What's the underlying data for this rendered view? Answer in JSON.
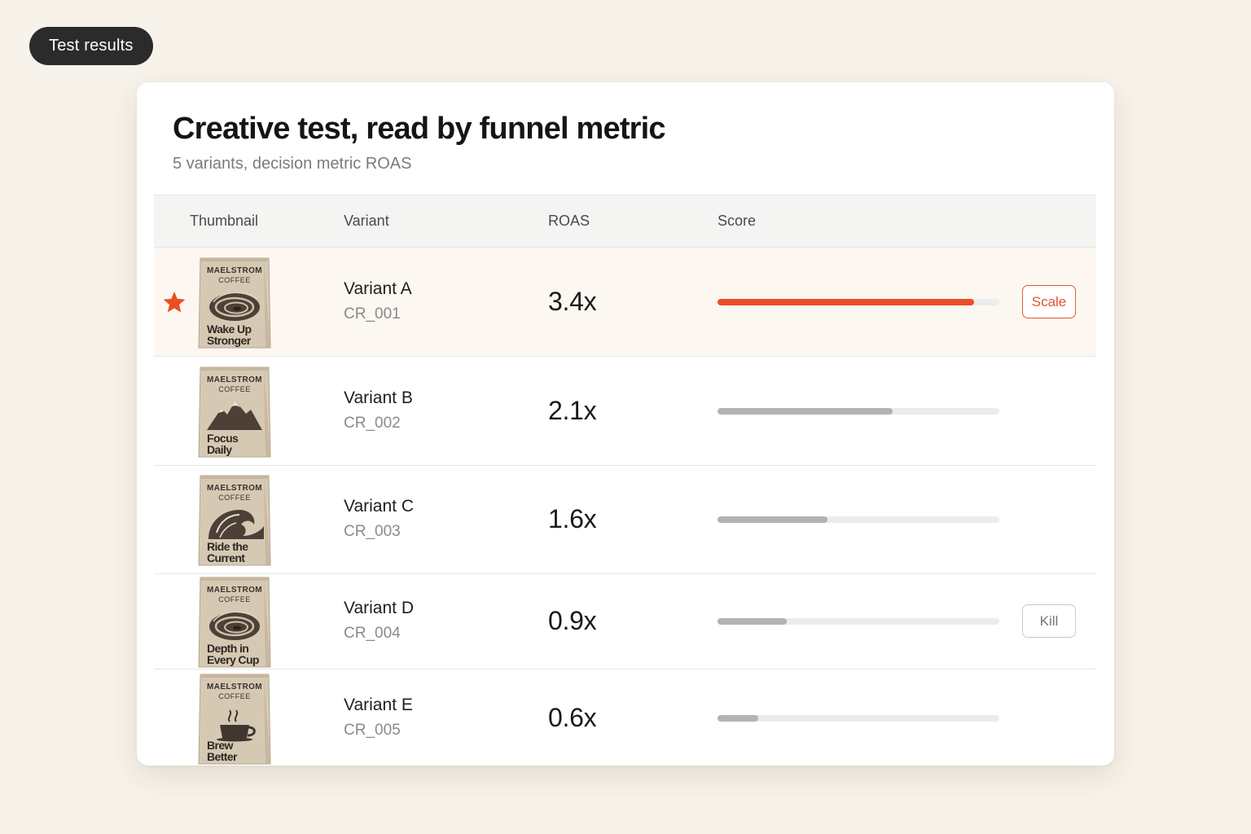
{
  "header": {
    "pill_label": "Test results"
  },
  "card": {
    "title": "Creative test, read by funnel metric",
    "subtitle": "5 variants, decision metric ROAS"
  },
  "table": {
    "columns": [
      "Thumbnail",
      "Variant",
      "ROAS",
      "Score"
    ],
    "rows": [
      {
        "variant": "Variant A",
        "code": "CR_001",
        "roas": "3.4x",
        "score": 0.91,
        "starred": true,
        "action": "Scale",
        "brand_top": "MAELSTROM",
        "brand_bottom": "COFFEE",
        "tagline_1": "Wake Up",
        "tagline_2": "Stronger",
        "art": "swirl"
      },
      {
        "variant": "Variant B",
        "code": "CR_002",
        "roas": "2.1x",
        "score": 0.62,
        "starred": false,
        "action": "",
        "brand_top": "MAELSTROM",
        "brand_bottom": "COFFEE",
        "tagline_1": "Focus",
        "tagline_2": "Daily",
        "art": "mountain"
      },
      {
        "variant": "Variant C",
        "code": "CR_003",
        "roas": "1.6x",
        "score": 0.39,
        "starred": false,
        "action": "",
        "brand_top": "MAELSTROM",
        "brand_bottom": "COFFEE",
        "tagline_1": "Ride the",
        "tagline_2": "Current",
        "art": "wave"
      },
      {
        "variant": "Variant D",
        "code": "CR_004",
        "roas": "0.9x",
        "score": 0.245,
        "starred": false,
        "action": "Kill",
        "brand_top": "MAELSTROM",
        "brand_bottom": "COFFEE",
        "tagline_1": "Depth in",
        "tagline_2": "Every Cup",
        "art": "swirl"
      },
      {
        "variant": "Variant E",
        "code": "CR_005",
        "roas": "0.6x",
        "score": 0.145,
        "starred": false,
        "action": "",
        "brand_top": "MAELSTROM",
        "brand_bottom": "COFFEE",
        "tagline_1": "Brew",
        "tagline_2": "Better",
        "art": "cup"
      }
    ]
  },
  "colors": {
    "accent": "#ea4e26",
    "bar_neutral": "#b3b3b3",
    "track": "#ececec",
    "pill_bg": "#2b2b2b",
    "page_bg": "#f7f2ea"
  }
}
